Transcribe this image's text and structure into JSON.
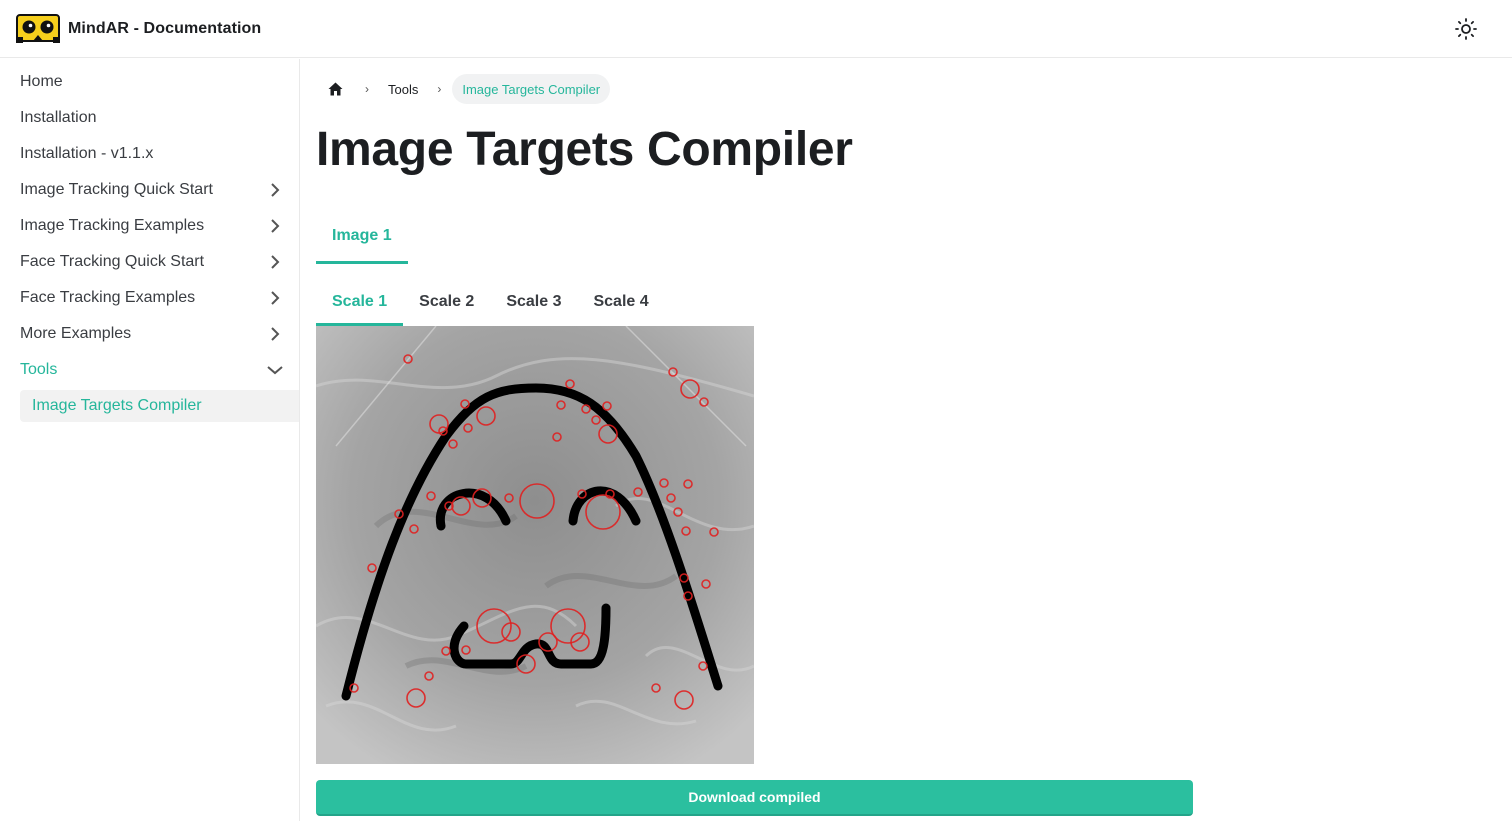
{
  "navbar": {
    "brand": "MindAR - Documentation",
    "logo_icon": "vr-goggles-logo",
    "theme_icon": "sun-icon"
  },
  "sidebar": {
    "items": [
      {
        "label": "Home",
        "expandable": false
      },
      {
        "label": "Installation",
        "expandable": false
      },
      {
        "label": "Installation - v1.1.x",
        "expandable": false
      },
      {
        "label": "Image Tracking Quick Start",
        "expandable": true
      },
      {
        "label": "Image Tracking Examples",
        "expandable": true
      },
      {
        "label": "Face Tracking Quick Start",
        "expandable": true
      },
      {
        "label": "Face Tracking Examples",
        "expandable": true
      },
      {
        "label": "More Examples",
        "expandable": true
      },
      {
        "label": "Tools",
        "expandable": true,
        "expanded": true
      }
    ],
    "sub_items": [
      {
        "label": "Image Targets Compiler",
        "active": true
      }
    ]
  },
  "breadcrumbs": {
    "home_icon": "home-icon",
    "items": [
      "Tools",
      "Image Targets Compiler"
    ]
  },
  "page": {
    "title": "Image Targets Compiler"
  },
  "image_tabs": [
    "Image 1"
  ],
  "scale_tabs": [
    "Scale 1",
    "Scale 2",
    "Scale 3",
    "Scale 4"
  ],
  "active_image_tab": "Image 1",
  "active_scale_tab": "Scale 1",
  "download_button": "Download compiled",
  "colors": {
    "accent": "#25b69b",
    "button": "#2bbf9f",
    "feature_point": "#e02020",
    "text": "#1c1e21"
  }
}
